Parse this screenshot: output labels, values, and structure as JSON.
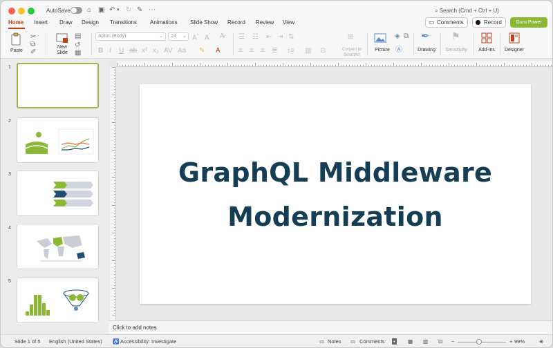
{
  "titlebar": {
    "autosave_label": "AutoSave",
    "search_placeholder": "Search (Cmd + Ctrl + U)"
  },
  "tabs": [
    {
      "label": "Home"
    },
    {
      "label": "Insert"
    },
    {
      "label": "Draw"
    },
    {
      "label": "Design"
    },
    {
      "label": "Transitions"
    },
    {
      "label": "Animations"
    },
    {
      "label": "Slide Show"
    },
    {
      "label": "Record"
    },
    {
      "label": "Review"
    },
    {
      "label": "View"
    }
  ],
  "header_buttons": {
    "comments_label": "Comments",
    "record_label": "Record",
    "guru_label": "Guru Power"
  },
  "ribbon": {
    "paste_label": "Paste",
    "new_slide_label": "New\nSlide",
    "font_name": "Aptos (Body)",
    "font_size": "24",
    "convert_label": "Convert to\nSmartArt",
    "picture_label": "Picture",
    "drawing_label": "Drawing",
    "sensitivity_label": "Sensitivity",
    "addins_label": "Add-ins",
    "designer_label": "Designer"
  },
  "thumbnails": [
    {
      "number": "1"
    },
    {
      "number": "2"
    },
    {
      "number": "3"
    },
    {
      "number": "4"
    },
    {
      "number": "5"
    }
  ],
  "slide": {
    "title_line1": "GraphQL Middleware",
    "title_line2": "Modernization"
  },
  "notes_placeholder": "Click to add notes",
  "statusbar": {
    "slide_info": "Slide 1 of 5",
    "language": "English (United States)",
    "accessibility": "Accessibility: Investigate",
    "notes_label": "Notes",
    "comments_label": "Comments",
    "zoom": "99%"
  },
  "colors": {
    "accent": "#c43e1c",
    "title_text": "#153e55",
    "thumb_selected": "#a4b44a",
    "guru_button": "#8bb834"
  }
}
